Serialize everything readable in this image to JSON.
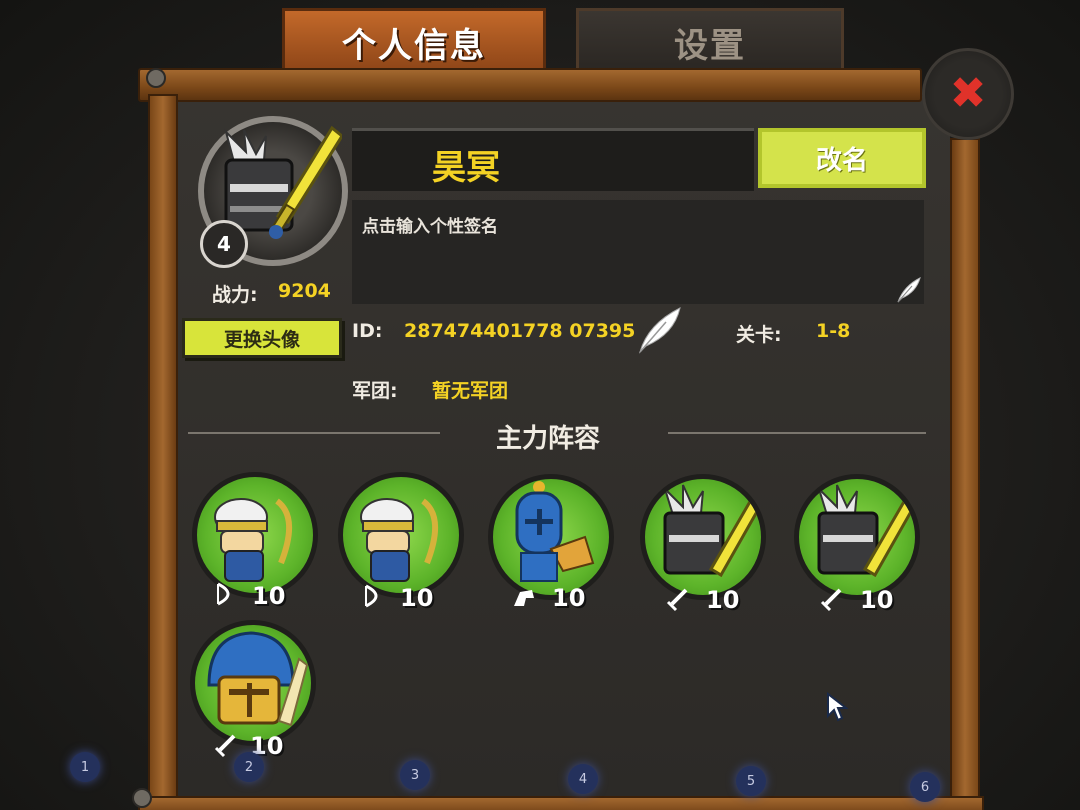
{
  "tabs": {
    "profile": "个人信息",
    "settings": "设置"
  },
  "player": {
    "level": "4",
    "power_label": "战力:",
    "power_value": "9204",
    "change_avatar_label": "更换头像",
    "name": "昊冥",
    "rename_label": "改名",
    "signature_placeholder": "点击输入个性签名",
    "id_label": "ID:",
    "id_value": "287474401778 07395",
    "stage_label": "关卡:",
    "stage_value": "1-8",
    "guild_label": "军团:",
    "guild_value": "暂无军团"
  },
  "lineup": {
    "title": "主力阵容",
    "heroes": [
      {
        "name": "archer-hero",
        "level": "10",
        "type_icon": "bow-icon"
      },
      {
        "name": "archer-hero",
        "level": "10",
        "type_icon": "bow-icon"
      },
      {
        "name": "cavalry-hero",
        "level": "10",
        "type_icon": "horse-icon"
      },
      {
        "name": "black-knight-hero",
        "level": "10",
        "type_icon": "sword-icon"
      },
      {
        "name": "black-knight-hero",
        "level": "10",
        "type_icon": "sword-icon"
      },
      {
        "name": "golden-knight-hero",
        "level": "10",
        "type_icon": "sword-icon"
      }
    ]
  },
  "pager": [
    "1",
    "2",
    "3",
    "4",
    "5",
    "6"
  ],
  "colors": {
    "accent_yellow": "#f4d224",
    "button_green": "#d4e34b",
    "hero_green": "#5db42a",
    "close_red": "#e0322a"
  }
}
